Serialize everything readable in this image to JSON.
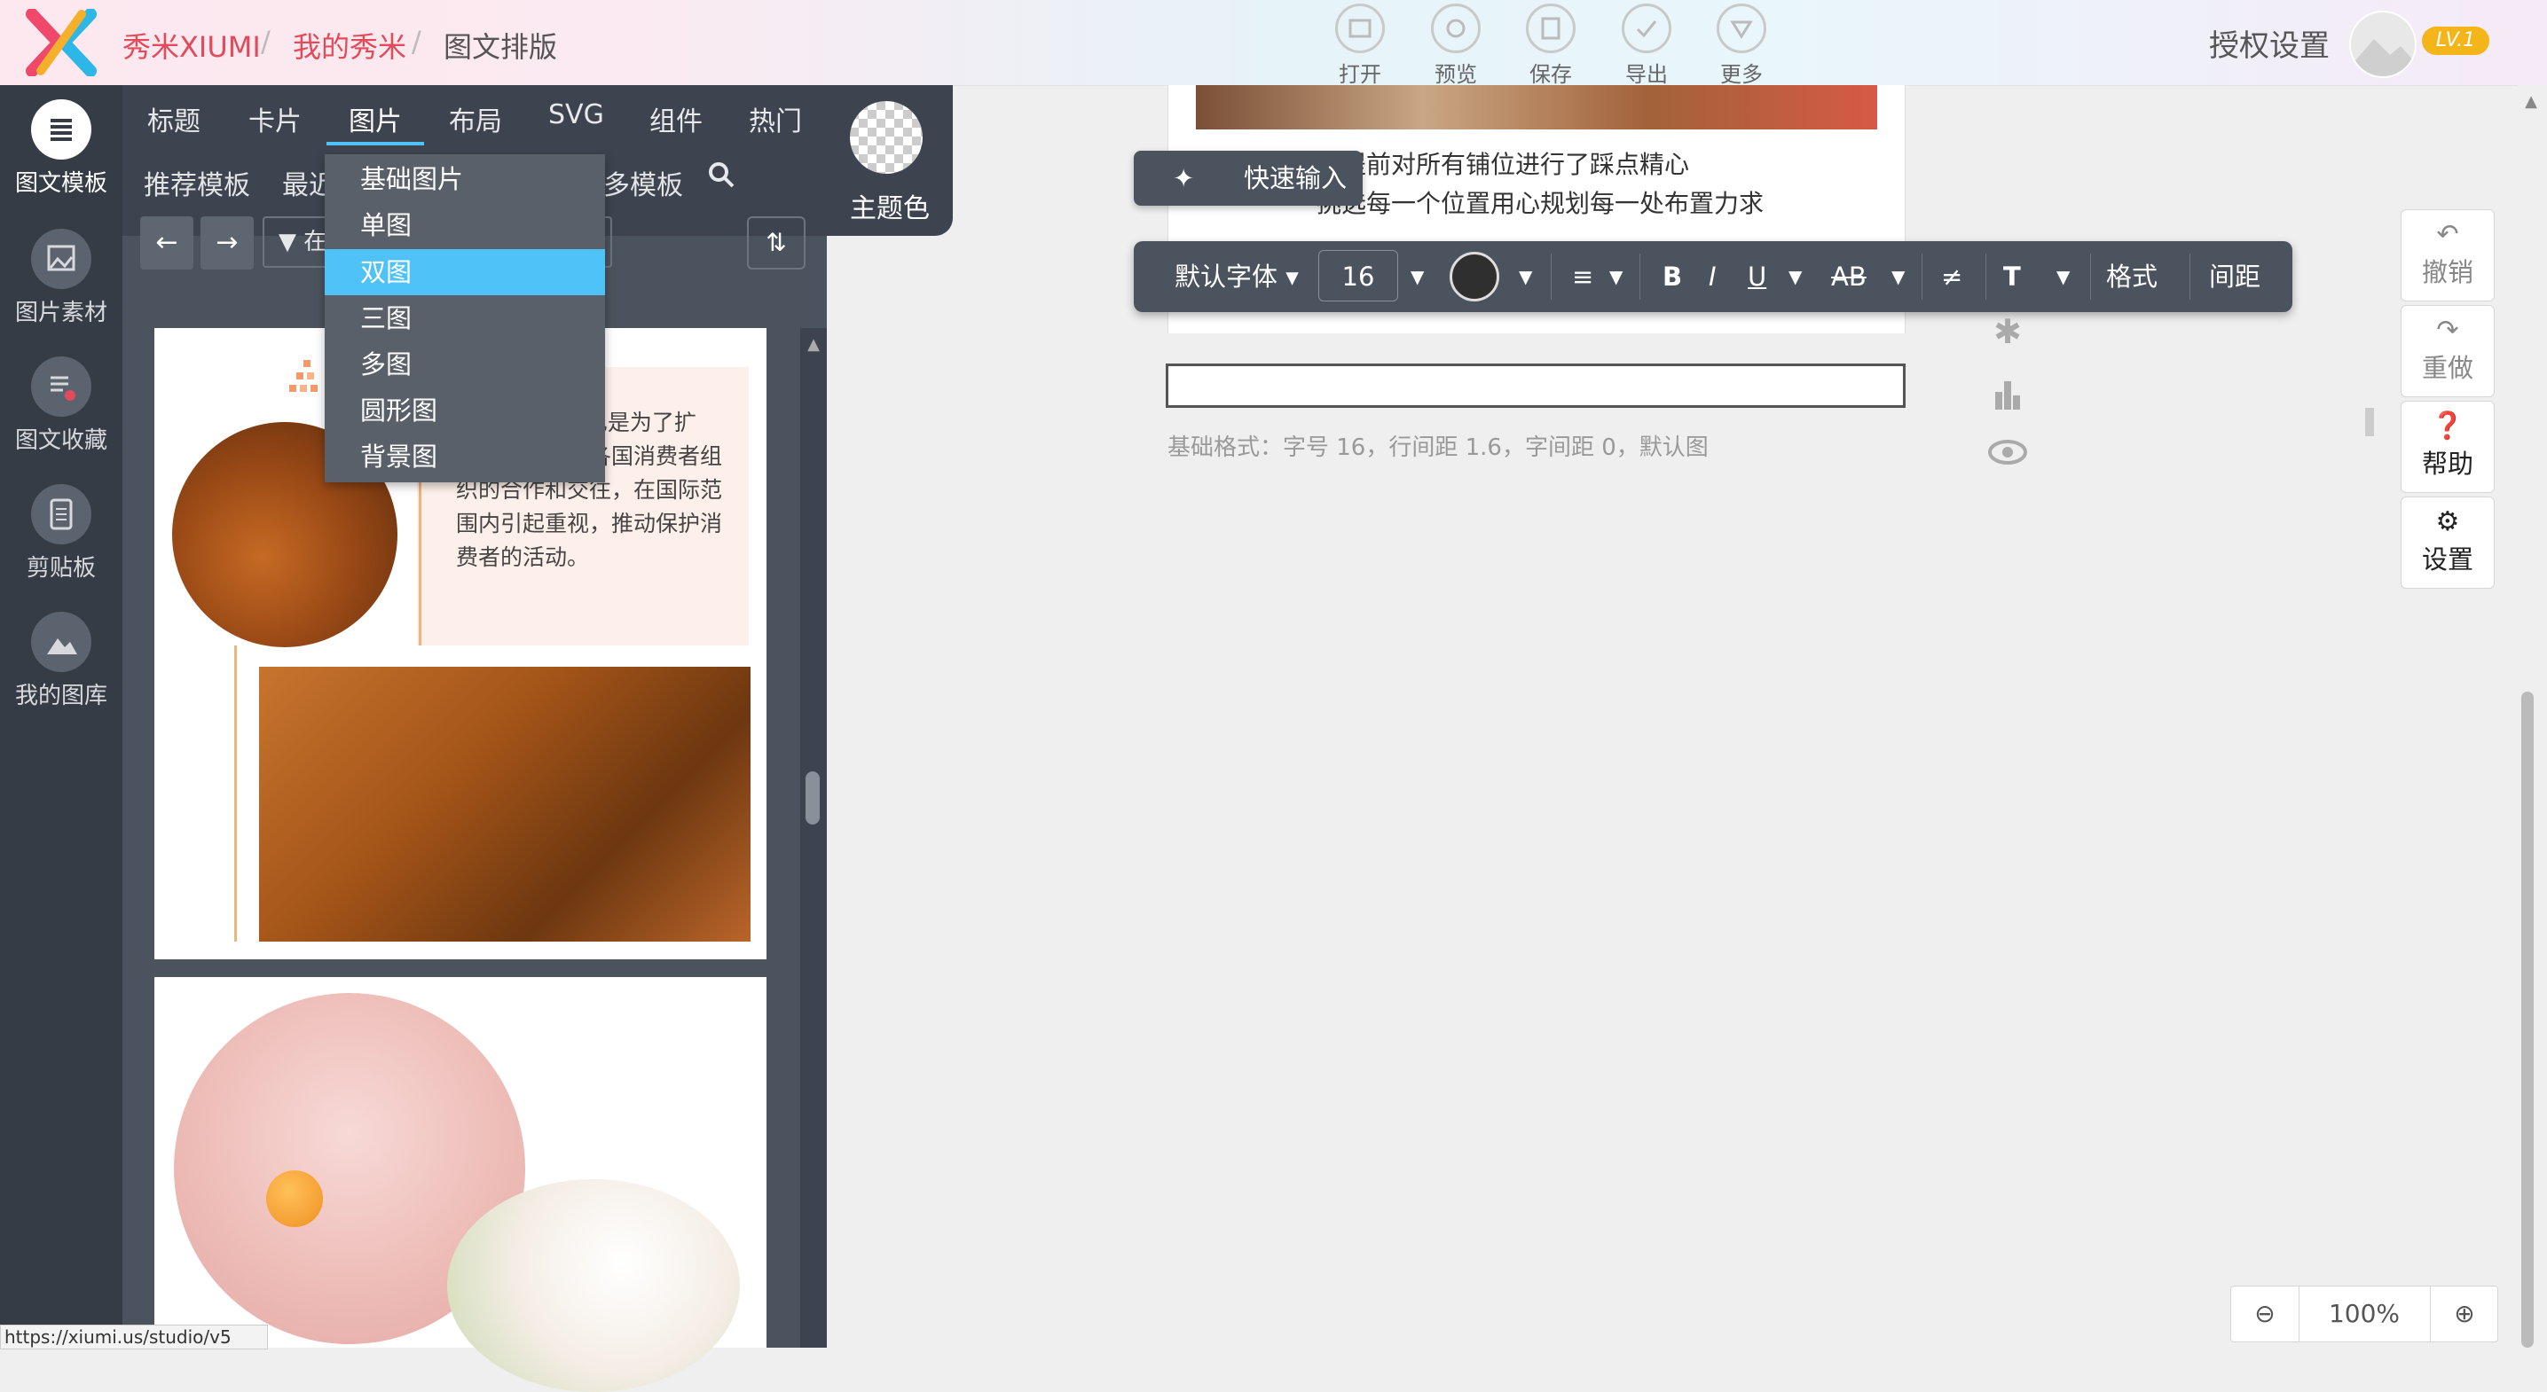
{
  "header": {
    "brand": "秀米XIUMI",
    "breadcrumb": [
      "我的秀米",
      "图文排版"
    ],
    "separator": "/",
    "tools": [
      {
        "label": "打开",
        "icon": "folder-icon"
      },
      {
        "label": "预览",
        "icon": "preview-icon"
      },
      {
        "label": "保存",
        "icon": "save-icon"
      },
      {
        "label": "导出",
        "icon": "export-icon"
      },
      {
        "label": "更多",
        "icon": "more-icon"
      }
    ],
    "auth": "授权设置",
    "level": "LV.1"
  },
  "rail": {
    "items": [
      {
        "label": "图文模板",
        "icon": "template-icon",
        "active": true
      },
      {
        "label": "图片素材",
        "icon": "image-icon"
      },
      {
        "label": "图文收藏",
        "icon": "favorite-icon"
      },
      {
        "label": "剪贴板",
        "icon": "clipboard-icon"
      },
      {
        "label": "我的图库",
        "icon": "gallery-icon"
      }
    ]
  },
  "panel": {
    "tabs": [
      "标题",
      "卡片",
      "图片",
      "布局",
      "SVG",
      "组件",
      "热门"
    ],
    "active_tab": "图片",
    "subtabs": [
      "推荐模板",
      "最近",
      "多模板"
    ],
    "theme_color_label": "主题色",
    "filter_label": "在",
    "card_text": "作为“国际消 也是为了扩 大宣传，促进各国消费者组织的合作和交往，在国际范围内引起重视，推动保护消费者的活动。"
  },
  "dropdown": {
    "items": [
      "基础图片",
      "单图",
      "双图",
      "三图",
      "多图",
      "圆形图",
      "背景图"
    ],
    "active": "双图"
  },
  "editor": {
    "doc_lines": [
      "队提前对所有铺位进行了踩点精心",
      "挑选每一个位置用心规划每一处布置力求"
    ],
    "quick_input": "快速输入",
    "toolbar": {
      "font": "默认字体",
      "size": "16",
      "bold": "B",
      "italic": "I",
      "underline": "U",
      "strike": "AB",
      "format": "格式",
      "spacing": "间距"
    },
    "basic_format": "基础格式：字号 16，行间距 1.6，字间距 0，默认图"
  },
  "right_panel": {
    "undo": "撤销",
    "redo": "重做",
    "help": "帮助",
    "settings": "设置"
  },
  "zoom": {
    "level": "100%"
  },
  "status_url": "https://xiumi.us/studio/v5"
}
